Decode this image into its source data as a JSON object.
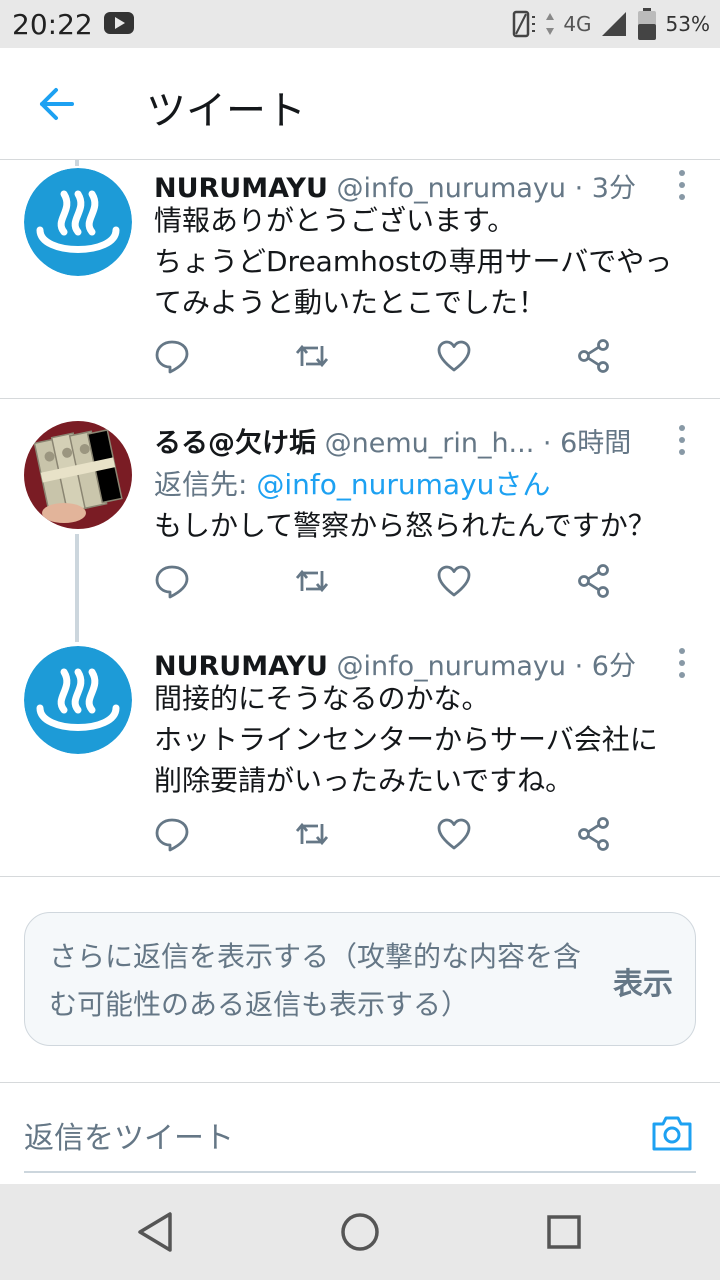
{
  "status_bar": {
    "time": "20:22",
    "network": "4G",
    "battery": "53%"
  },
  "header": {
    "title": "ツイート",
    "back_icon": "arrow-left-icon"
  },
  "tweets": [
    {
      "name": "NURUMAYU",
      "handle": "@info_nurumayu",
      "separator": "·",
      "time": "3分",
      "text_lines": [
        "情報ありがとうございます。",
        "ちょうどDreamhostの専用サーバでやっ",
        "てみようと動いたとこでした！"
      ],
      "avatar": "onsen-icon"
    },
    {
      "name": "るる@欠け垢",
      "handle": "@nemu_rin_h...",
      "separator": "·",
      "time": "6時間",
      "reply_to_label": "返信先: ",
      "reply_to_mention": "@info_nurumayuさん",
      "text_lines": [
        "もしかして警察から怒られたんですか？"
      ],
      "avatar": "money-photo-avatar"
    },
    {
      "name": "NURUMAYU",
      "handle": "@info_nurumayu",
      "separator": "·",
      "time": "6分",
      "text_lines": [
        "間接的にそうなるのかな。",
        "ホットラインセンターからサーバ会社に",
        "削除要請がいったみたいですね。"
      ],
      "avatar": "onsen-icon"
    }
  ],
  "more_replies": {
    "description": "さらに返信を表示する（攻撃的な内容を含む可能性のある返信も表示する）",
    "action": "表示"
  },
  "compose": {
    "placeholder": "返信をツイート",
    "camera_icon": "camera-icon"
  },
  "colors": {
    "accent": "#1da1f2",
    "secondary_text": "#657786",
    "icon_gray": "#657786",
    "avatar_blue": "#1d9bd7"
  }
}
